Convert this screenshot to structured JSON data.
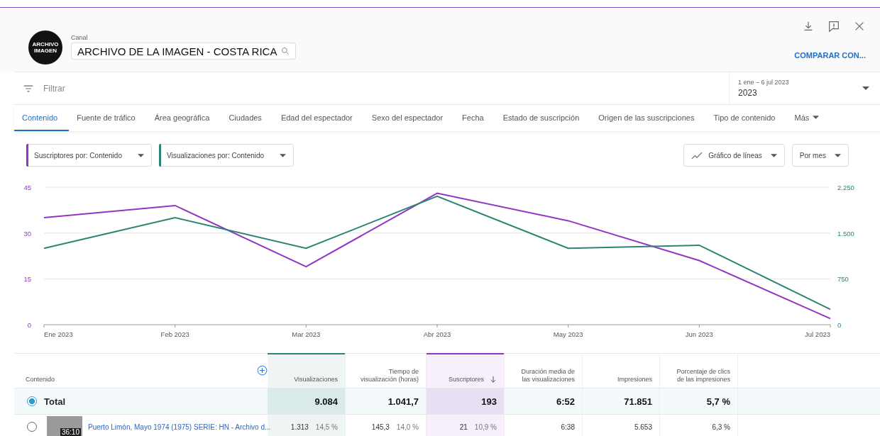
{
  "header": {
    "channel_label": "Canal",
    "channel_value": "ARCHIVO DE LA IMAGEN - COSTA RICA",
    "avatar_text": [
      "ARCHIVO",
      "IMAGEN"
    ],
    "compare_button": "COMPARAR CON..."
  },
  "filter": {
    "placeholder": "Filtrar"
  },
  "date_selector": {
    "range": "1 ene – 6 jul 2023",
    "value": "2023"
  },
  "tabs": [
    {
      "label": "Contenido",
      "selected": true
    },
    {
      "label": "Fuente de tráfico",
      "selected": false
    },
    {
      "label": "Área geográfica",
      "selected": false
    },
    {
      "label": "Ciudades",
      "selected": false
    },
    {
      "label": "Edad del espectador",
      "selected": false
    },
    {
      "label": "Sexo del espectador",
      "selected": false
    },
    {
      "label": "Fecha",
      "selected": false
    },
    {
      "label": "Estado de suscripción",
      "selected": false
    },
    {
      "label": "Origen de las suscripciones",
      "selected": false
    },
    {
      "label": "Tipo de contenido",
      "selected": false
    }
  ],
  "more_tab": {
    "label": "Más"
  },
  "metric_selectors": [
    {
      "label": "Suscriptores por: Contenido",
      "color": "#9334c4"
    },
    {
      "label": "Visualizaciones por: Contenido",
      "color": "#2b8475"
    }
  ],
  "chart_type_selector": {
    "label": "Gráfico de líneas"
  },
  "period_selector": {
    "label": "Por mes"
  },
  "chart_data": {
    "type": "line",
    "categories": [
      "Ene 2023",
      "Feb 2023",
      "Mar 2023",
      "Abr 2023",
      "May 2023",
      "Jun 2023",
      "Jul 2023"
    ],
    "ylim": [
      0,
      45
    ],
    "yticks": [
      0,
      15,
      30,
      45
    ],
    "y2lim": [
      0,
      2250
    ],
    "y2ticks": [
      {
        "value": 0,
        "label": "0"
      },
      {
        "value": 750,
        "label": "750"
      },
      {
        "value": 1500,
        "label": "1.500"
      },
      {
        "value": 2250,
        "label": "2.250"
      }
    ],
    "series": [
      {
        "color": "#9334c4",
        "values": [
          35,
          39,
          19,
          43,
          34,
          21,
          2
        ]
      },
      {
        "color": "#2b8475",
        "axis": "y2",
        "values": [
          1250,
          1750,
          1250,
          2100,
          1250,
          1300,
          250
        ]
      }
    ]
  },
  "table": {
    "columns": [
      {
        "label": "Contenido",
        "kind": "name",
        "sorted": false
      },
      {
        "label": "Visualizaciones",
        "kind": "metric",
        "color": "#2b8475",
        "sorted": false
      },
      {
        "label": "Tiempo de visualización (horas)",
        "kind": "metric",
        "sorted": false
      },
      {
        "label": "Suscriptores",
        "kind": "metric",
        "color": "#9334c4",
        "sorted": true
      },
      {
        "label": "Duración media de las visualizaciones",
        "kind": "metric",
        "sorted": false
      },
      {
        "label": "Impresiones",
        "kind": "metric",
        "sorted": false
      },
      {
        "label": "Porcentaje de clics de las impresiones",
        "kind": "metric",
        "sorted": false
      }
    ],
    "rows": [
      {
        "kind": "total",
        "selected": true,
        "cells": [
          {
            "value": "Total"
          },
          {
            "value": "9.084"
          },
          {
            "value": "1.041,7"
          },
          {
            "value": "193"
          },
          {
            "value": "6:52"
          },
          {
            "value": "71.851"
          },
          {
            "value": "5,7 %"
          }
        ]
      },
      {
        "kind": "video",
        "selected": false,
        "cells": [
          {
            "value": "Puerto Limón, Mayo 1974 (1975) SERIE: HN - Archivo d...",
            "duration": "36:10"
          },
          {
            "value": "1.313",
            "share": "14,5 %"
          },
          {
            "value": "145,3",
            "share": "14,0 %"
          },
          {
            "value": "21",
            "share": "10,9 %"
          },
          {
            "value": "6:38"
          },
          {
            "value": "5.653"
          },
          {
            "value": "6,3 %"
          }
        ]
      }
    ]
  }
}
